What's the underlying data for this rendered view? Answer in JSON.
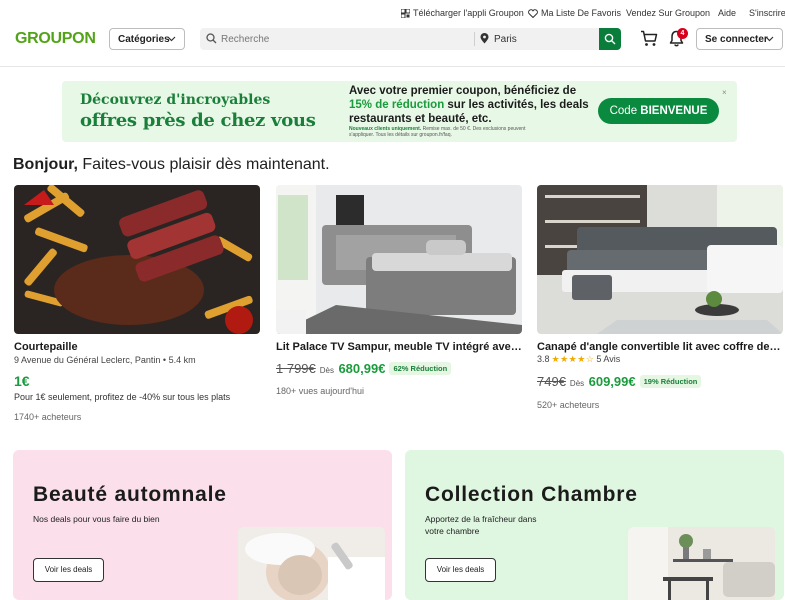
{
  "topbar": {
    "app_link": "Télécharger l'appli Groupon",
    "favorites": "Ma Liste De Favoris",
    "sell": "Vendez Sur Groupon",
    "help": "Aide",
    "signup": "S'inscrire"
  },
  "header": {
    "logo": "GROUPON",
    "categories_label": "Catégories",
    "search_placeholder": "Recherche",
    "location": "Paris",
    "notifications_count": "4",
    "login_label": "Se connecter"
  },
  "banner": {
    "line1": "Découvrez d'incroyables",
    "line2": "offres près de chez vous",
    "text_a": "Avec votre premier coupon, bénéficiez de ",
    "text_highlight": "15% de réduction",
    "text_b": " sur les activités, les deals restaurants et beauté, etc.",
    "fine_bold": "Nouveaux clients uniquement.",
    "fine": " Remise max. de 50 €. Des exclusions peuvent s'appliquer. Tous les détails sur groupon.fr/faq.",
    "code_prefix": "Code ",
    "code": "BIENVENUE",
    "close": "×"
  },
  "greeting": {
    "bold": "Bonjour,",
    "rest": " Faites-vous plaisir dès maintenant."
  },
  "deals": [
    {
      "title": "Courtepaille",
      "subtitle": "9 Avenue du Général Leclerc, Pantin • 5.4 km",
      "price": "1€",
      "description": "Pour 1€ seulement, profitez de -40% sur tous les plats",
      "buyers": "1740+ acheteurs"
    },
    {
      "title": "Lit Palace TV Sampur, meuble TV intégré avec …",
      "old_price": "1 799€",
      "from": "Dès",
      "new_price": "680,99€",
      "discount": "62% Réduction",
      "views": "180+ vues aujourd'hui"
    },
    {
      "title": "Canapé d'angle convertible lit avec coffre de r…",
      "rating": "3.8",
      "stars": "★★★★☆",
      "reviews": "5 Avis",
      "old_price": "749€",
      "from": "Dès",
      "new_price": "609,99€",
      "discount": "19% Réduction",
      "buyers": "520+ acheteurs"
    }
  ],
  "collections": [
    {
      "title": "Beauté automnale",
      "description": "Nos deals pour vous faire du bien",
      "button": "Voir les deals"
    },
    {
      "title": "Collection Chambre",
      "description": "Apportez de la fraîcheur dans votre chambre",
      "button": "Voir les deals"
    }
  ],
  "colors": {
    "brand_green": "#53a318",
    "deal_green": "#1a9b3c",
    "cta_green": "#0a8a3f",
    "badge_red": "#d6001c"
  }
}
